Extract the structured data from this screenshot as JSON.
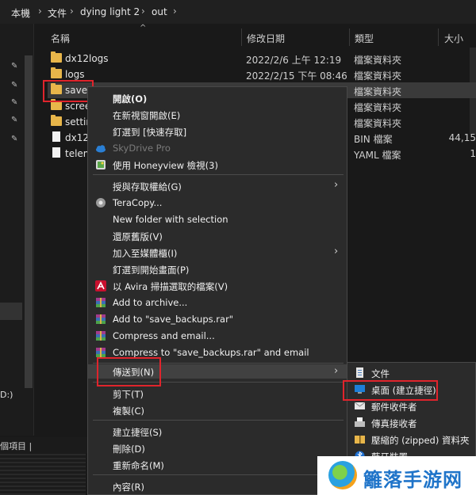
{
  "breadcrumb": {
    "items": [
      "本機",
      "文件",
      "dying light 2",
      "out"
    ],
    "sep": "›"
  },
  "columns": {
    "name": "名稱",
    "date": "修改日期",
    "type": "類型",
    "size": "大小"
  },
  "files": [
    {
      "name": "dx12logs",
      "date": "2022/2/6 上午 12:19",
      "type": "檔案資料夾",
      "size": "",
      "kind": "folder"
    },
    {
      "name": "logs",
      "date": "2022/2/15 下午 08:46",
      "type": "檔案資料夾",
      "size": "",
      "kind": "folder"
    },
    {
      "name": "save",
      "date": "",
      "type": "檔案資料夾",
      "size": "",
      "kind": "folder"
    },
    {
      "name": "scree",
      "date": "",
      "type": "檔案資料夾",
      "size": "",
      "kind": "folder"
    },
    {
      "name": "settin",
      "date": "",
      "type": "檔案資料夾",
      "size": "",
      "kind": "folder"
    },
    {
      "name": "dx12",
      "date": "",
      "type": "BIN 檔案",
      "size": "44,15",
      "kind": "file"
    },
    {
      "name": "telem",
      "date": "",
      "type": "YAML 檔案",
      "size": "1",
      "kind": "file"
    }
  ],
  "nav": {
    "drive_label": "D:)"
  },
  "status": {
    "text": "個項目  |"
  },
  "context_menu": {
    "items": [
      {
        "label": "開啟(O)",
        "bold": true
      },
      {
        "label": "在新視窗開啟(E)"
      },
      {
        "label": "釘選到 [快速存取]"
      },
      {
        "label": "SkyDrive Pro",
        "disabled": true,
        "icon": "cloud-icon"
      },
      {
        "label": "使用 Honeyview 檢視(3)",
        "icon": "honeyview-icon"
      },
      {
        "label": "授與存取權給(G)",
        "arrow": true
      },
      {
        "label": "TeraCopy...",
        "icon": "teracopy-icon"
      },
      {
        "label": "New folder with selection"
      },
      {
        "label": "還原舊版(V)"
      },
      {
        "label": "加入至媒體櫃(I)",
        "arrow": true
      },
      {
        "label": "釘選到開始畫面(P)"
      },
      {
        "label": "以 Avira 掃描選取的檔案(V)",
        "icon": "avira-icon"
      },
      {
        "label": "Add to archive...",
        "icon": "winrar-icon"
      },
      {
        "label": "Add to \"save_backups.rar\"",
        "icon": "winrar-icon"
      },
      {
        "label": "Compress and email...",
        "icon": "winrar-icon"
      },
      {
        "label": "Compress to \"save_backups.rar\" and email",
        "icon": "winrar-icon"
      },
      {
        "label": "傳送到(N)",
        "arrow": true,
        "highlight": true
      },
      {
        "label": "剪下(T)"
      },
      {
        "label": "複製(C)"
      },
      {
        "label": "建立捷徑(S)"
      },
      {
        "label": "刪除(D)"
      },
      {
        "label": "重新命名(M)"
      },
      {
        "label": "內容(R)"
      }
    ]
  },
  "send_to": {
    "items": [
      {
        "label": "文件",
        "icon": "document-icon"
      },
      {
        "label": "桌面 (建立捷徑)",
        "icon": "desktop-icon"
      },
      {
        "label": "郵件收件者",
        "icon": "mail-icon"
      },
      {
        "label": "傳真接收者",
        "icon": "fax-icon"
      },
      {
        "label": "壓縮的 (zipped) 資料夾",
        "icon": "zip-folder-icon"
      },
      {
        "label": "藍牙裝置",
        "icon": "bluetooth-icon"
      }
    ]
  },
  "watermark": {
    "text": "籬落手游网"
  },
  "colors": {
    "highlight_box": "#e0242c",
    "folder": "#e8b64a",
    "menu_bg": "#2b2b2b"
  }
}
